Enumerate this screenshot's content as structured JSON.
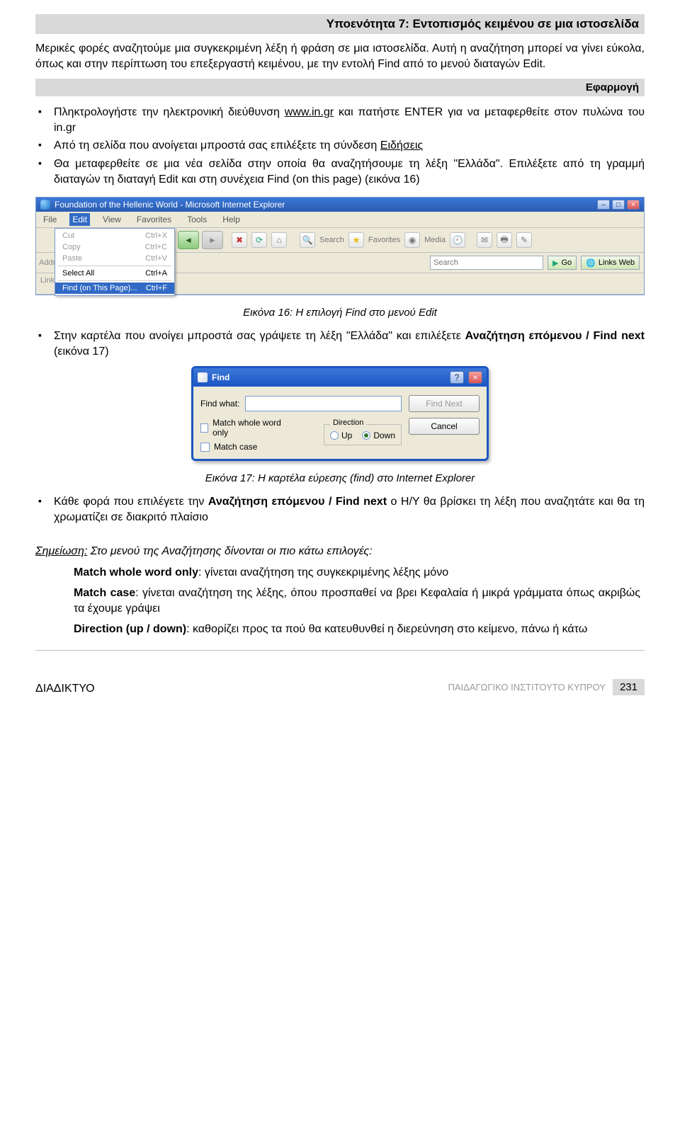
{
  "title_bar": "Υποενότητα 7:  Εντοπισμός κειμένου σε μια ιστοσελίδα",
  "intro_para": "Μερικές φορές αναζητούμε μια συγκεκριμένη λέξη ή φράση σε μια ιστοσελίδα. Αυτή η αναζήτηση μπορεί να γίνει εύκολα, όπως και στην περίπτωση του επεξεργαστή κειμένου, με την εντολή Find από το μενού διαταγών Edit.",
  "efarmogi_label": "Εφαρμογή",
  "bullets1": {
    "b1_a": "Πληκτρολογήστε την ηλεκτρονική διεύθυνση ",
    "b1_link": "www.in.gr",
    "b1_b": " και πατήστε ENTER για να μεταφερθείτε στον πυλώνα του in.gr",
    "b2_a": "Από τη σελίδα που ανοίγεται μπροστά σας επιλέξετε τη σύνδεση ",
    "b2_u": "Ειδήσεις",
    "b3": "Θα μεταφερθείτε σε μια νέα σελίδα στην οποία θα αναζητήσουμε τη λέξη \"Ελλάδα\". Επιλέξετε από τη γραμμή διαταγών τη διαταγή Edit και στη συνέχεια Find (on this page) (εικόνα 16)"
  },
  "ie": {
    "title": "Foundation of the Hellenic World - Microsoft Internet Explorer",
    "menu": {
      "file": "File",
      "edit": "Edit",
      "view": "View",
      "favorites": "Favorites",
      "tools": "Tools",
      "help": "Help"
    },
    "editmenu": {
      "cut": "Cut",
      "cut_k": "Ctrl+X",
      "copy": "Copy",
      "copy_k": "Ctrl+C",
      "paste": "Paste",
      "paste_k": "Ctrl+V",
      "selectall": "Select All",
      "selectall_k": "Ctrl+A",
      "find": "Find (on This Page)...",
      "find_k": "Ctrl+F"
    },
    "toolbar": {
      "search": "Search",
      "favorites": "Favorites",
      "media": "Media"
    },
    "address_label": "Address",
    "address_placeholder": "",
    "search_placeholder": "Search",
    "go": "Go",
    "links_label": "Links",
    "links_btn": "Links Web"
  },
  "caption16": "Εικόνα 16: Η επιλογή Find στο μενού Edit",
  "bullets2": {
    "b4_a": "Στην καρτέλα που ανοίγει μπροστά σας γράψετε τη λέξη \"Ελλάδα\" και επιλέξετε ",
    "b4_bold": "Αναζήτηση επόμενου / Find next",
    "b4_b": " (εικόνα 17)"
  },
  "find": {
    "title": "Find",
    "findwhat": "Find what:",
    "findnext": "Find Next",
    "cancel": "Cancel",
    "matchwhole": "Match whole word only",
    "matchcase": "Match case",
    "direction": "Direction",
    "up": "Up",
    "down": "Down"
  },
  "caption17": "Εικόνα 17: Η καρτέλα εύρεσης (find) στο Internet Explorer",
  "bullets3": {
    "b5_a": "Κάθε φορά που επιλέγετε την ",
    "b5_bold": "Αναζήτηση επόμενου / Find next",
    "b5_b": " ο Η/Υ θα βρίσκει τη λέξη που αναζητάτε και θα τη χρωματίζει σε διακριτό πλαίσιο"
  },
  "note": {
    "heading_u": "Σημείωση:",
    "heading_rest": " Στο μενού της Αναζήτησης δίνονται οι πιο κάτω επιλογές:",
    "m1_b": "Match whole word only",
    "m1_r": ": γίνεται αναζήτηση της συγκεκριμένης λέξης μόνο",
    "m2_b": "Match case",
    "m2_r": ": γίνεται αναζήτηση της λέξης, όπου προσπαθεί να βρει Κεφαλαία ή μικρά γράμματα όπως ακριβώς τα έχουμε γράψει",
    "m3_b": "Direction (up / down)",
    "m3_r": ": καθορίζει προς τα πού θα κατευθυνθεί η διερεύνηση στο κείμενο, πάνω ή κάτω"
  },
  "footer": {
    "left": "ΔΙΑΔΙΚΤΥΟ",
    "inst": "ΠΑΙΔΑΓΩΓΙΚΟ ΙΝΣΤΙΤΟΥΤΟ ΚΥΠΡΟΥ",
    "page": "231"
  }
}
